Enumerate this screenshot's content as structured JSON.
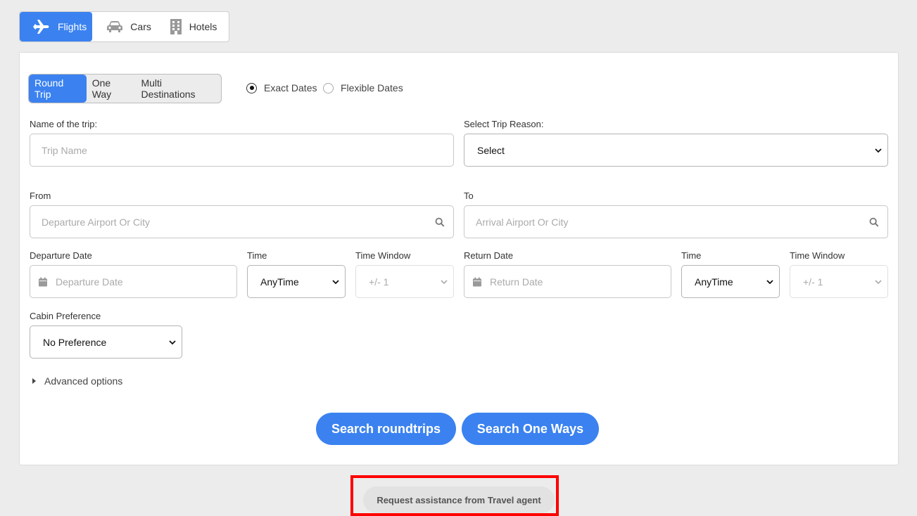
{
  "tabs": [
    {
      "label": "Flights",
      "icon": "airplane-icon",
      "active": true
    },
    {
      "label": "Cars",
      "icon": "car-icon",
      "active": false
    },
    {
      "label": "Hotels",
      "icon": "building-icon",
      "active": false
    }
  ],
  "trip_types": [
    {
      "label": "Round Trip",
      "active": true
    },
    {
      "label": "One Way",
      "active": false
    },
    {
      "label": "Multi Destinations",
      "active": false
    }
  ],
  "date_mode": {
    "exact": {
      "label": "Exact Dates",
      "checked": true
    },
    "flexible": {
      "label": "Flexible Dates",
      "checked": false
    }
  },
  "trip_name": {
    "label": "Name of the trip:",
    "placeholder": "Trip Name",
    "value": ""
  },
  "trip_reason": {
    "label": "Select Trip Reason:",
    "value": "Select"
  },
  "from": {
    "label": "From",
    "placeholder": "Departure Airport Or City"
  },
  "to": {
    "label": "To",
    "placeholder": "Arrival Airport Or City"
  },
  "departure": {
    "date_label": "Departure Date",
    "date_placeholder": "Departure Date",
    "time_label": "Time",
    "time_value": "AnyTime",
    "window_label": "Time Window",
    "window_value": "+/- 1"
  },
  "return": {
    "date_label": "Return Date",
    "date_placeholder": "Return Date",
    "time_label": "Time",
    "time_value": "AnyTime",
    "window_label": "Time Window",
    "window_value": "+/- 1"
  },
  "cabin": {
    "label": "Cabin Preference",
    "value": "No Preference"
  },
  "advanced_options": "Advanced options",
  "buttons": {
    "search_roundtrips": "Search roundtrips",
    "search_one_ways": "Search One Ways"
  },
  "assist": {
    "label": "Request assistance from Travel agent"
  },
  "colors": {
    "accent": "#3b82f0",
    "highlight": "#ff0000",
    "background": "#ececec"
  }
}
